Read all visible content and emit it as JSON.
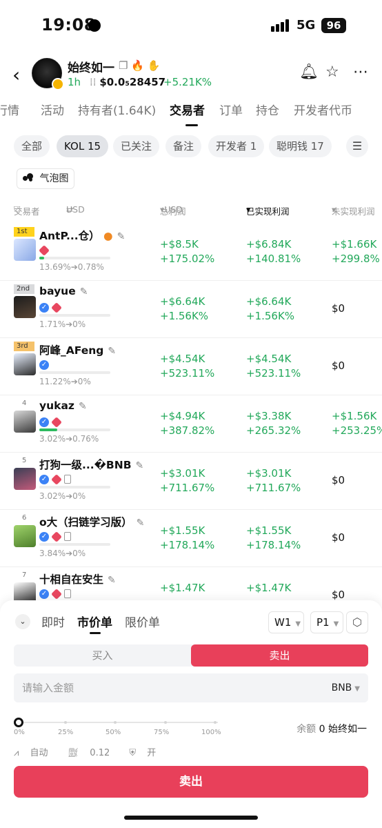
{
  "status_bar": {
    "time": "19:08",
    "network": "5G",
    "battery": "96"
  },
  "header": {
    "token_name": "始终如一",
    "age": "1h",
    "price": "$0.0₅28457",
    "change": "+5.21K%"
  },
  "tabs": [
    "行情",
    "活动",
    "持有者(1.64K)",
    "交易者",
    "订单",
    "持仓",
    "开发者代币"
  ],
  "filters": [
    "全部",
    "KOL 15",
    "已关注",
    "备注",
    "开发者 1",
    "聪明钱 17"
  ],
  "bubble_label": "气泡图",
  "table_header": {
    "trader": "交易者",
    "currency": "USD",
    "total_pnl": "总利润",
    "total_pnl_unit": "USD",
    "realized": "已实现利润",
    "unrealized": "未实现利润"
  },
  "traders": [
    {
      "rank": "1st",
      "name": "AntP...仓）",
      "pct": "13.69%➔0.78%",
      "bar": 0.07,
      "total": [
        "+$8.5K",
        "+175.02%"
      ],
      "realized": [
        "+$6.84K",
        "+140.81%"
      ],
      "unrealized": [
        "+$1.66K",
        "+299.8%"
      ]
    },
    {
      "rank": "2nd",
      "name": "bayue",
      "pct": "1.71%➔0%",
      "bar": 0,
      "total": [
        "+$6.64K",
        "+1.56K%"
      ],
      "realized": [
        "+$6.64K",
        "+1.56K%"
      ],
      "unrealized": [
        "$0"
      ]
    },
    {
      "rank": "3rd",
      "name": "阿峰_AFeng",
      "pct": "11.22%➔0%",
      "bar": 0,
      "total": [
        "+$4.54K",
        "+523.11%"
      ],
      "realized": [
        "+$4.54K",
        "+523.11%"
      ],
      "unrealized": [
        "$0"
      ]
    },
    {
      "rank": "4",
      "name": "yukaz",
      "pct": "3.02%➔0.76%",
      "bar": 0.25,
      "total": [
        "+$4.94K",
        "+387.82%"
      ],
      "realized": [
        "+$3.38K",
        "+265.32%"
      ],
      "unrealized": [
        "+$1.56K",
        "+253.25%"
      ]
    },
    {
      "rank": "5",
      "name": "打狗一级...�BNB",
      "pct": "3.02%➔0%",
      "bar": 0,
      "total": [
        "+$3.01K",
        "+711.67%"
      ],
      "realized": [
        "+$3.01K",
        "+711.67%"
      ],
      "unrealized": [
        "$0"
      ]
    },
    {
      "rank": "6",
      "name": "o大（扫链学习版）",
      "pct": "3.84%➔0%",
      "bar": 0,
      "total": [
        "+$1.55K",
        "+178.14%"
      ],
      "realized": [
        "+$1.55K",
        "+178.14%"
      ],
      "unrealized": [
        "$0"
      ]
    },
    {
      "rank": "7",
      "name": "十相自在安生",
      "pct": "",
      "bar": 0,
      "total": [
        "+$1.47K",
        ""
      ],
      "realized": [
        "+$1.47K",
        ""
      ],
      "unrealized": [
        "$0"
      ]
    }
  ],
  "trade_panel": {
    "order_tabs": [
      "即时",
      "市价单",
      "限价单"
    ],
    "w_select": "W1",
    "p_select": "P1",
    "buy_label": "买入",
    "sell_label": "卖出",
    "amount_placeholder": "请输入金额",
    "amount_unit": "BNB",
    "slider_labels": [
      "0%",
      "25%",
      "50%",
      "75%",
      "100%"
    ],
    "slider_value": 0,
    "balance_label": "余额",
    "balance_value": "0 始终如一",
    "auto_label": "自动",
    "gas_value": "0.12",
    "mev_label": "开",
    "submit_label": "卖出"
  },
  "colors": {
    "green": "#22a85a",
    "sell": "#e8405a"
  }
}
